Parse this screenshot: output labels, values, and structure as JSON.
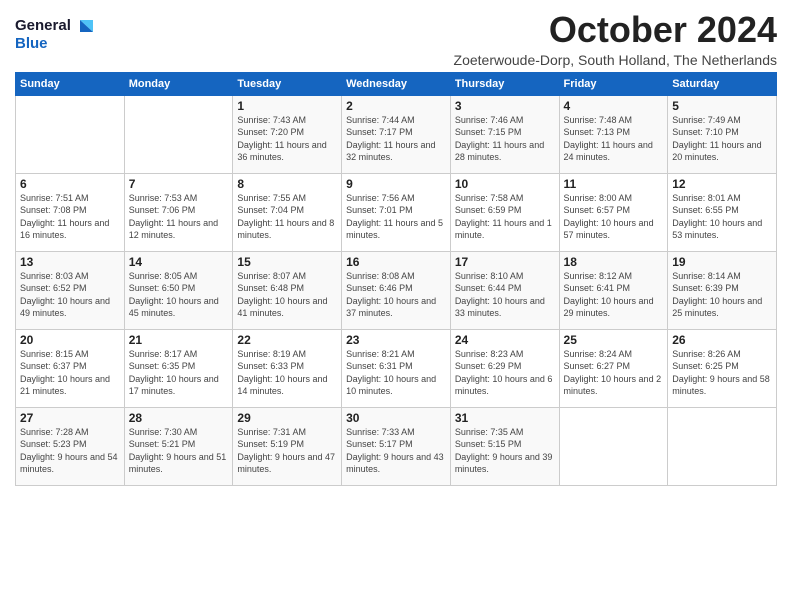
{
  "header": {
    "logo_general": "General",
    "logo_blue": "Blue",
    "month_title": "October 2024",
    "location": "Zoeterwoude-Dorp, South Holland, The Netherlands"
  },
  "days_of_week": [
    "Sunday",
    "Monday",
    "Tuesday",
    "Wednesday",
    "Thursday",
    "Friday",
    "Saturday"
  ],
  "weeks": [
    [
      {
        "day": "",
        "sunrise": "",
        "sunset": "",
        "daylight": ""
      },
      {
        "day": "",
        "sunrise": "",
        "sunset": "",
        "daylight": ""
      },
      {
        "day": "1",
        "sunrise": "Sunrise: 7:43 AM",
        "sunset": "Sunset: 7:20 PM",
        "daylight": "Daylight: 11 hours and 36 minutes."
      },
      {
        "day": "2",
        "sunrise": "Sunrise: 7:44 AM",
        "sunset": "Sunset: 7:17 PM",
        "daylight": "Daylight: 11 hours and 32 minutes."
      },
      {
        "day": "3",
        "sunrise": "Sunrise: 7:46 AM",
        "sunset": "Sunset: 7:15 PM",
        "daylight": "Daylight: 11 hours and 28 minutes."
      },
      {
        "day": "4",
        "sunrise": "Sunrise: 7:48 AM",
        "sunset": "Sunset: 7:13 PM",
        "daylight": "Daylight: 11 hours and 24 minutes."
      },
      {
        "day": "5",
        "sunrise": "Sunrise: 7:49 AM",
        "sunset": "Sunset: 7:10 PM",
        "daylight": "Daylight: 11 hours and 20 minutes."
      }
    ],
    [
      {
        "day": "6",
        "sunrise": "Sunrise: 7:51 AM",
        "sunset": "Sunset: 7:08 PM",
        "daylight": "Daylight: 11 hours and 16 minutes."
      },
      {
        "day": "7",
        "sunrise": "Sunrise: 7:53 AM",
        "sunset": "Sunset: 7:06 PM",
        "daylight": "Daylight: 11 hours and 12 minutes."
      },
      {
        "day": "8",
        "sunrise": "Sunrise: 7:55 AM",
        "sunset": "Sunset: 7:04 PM",
        "daylight": "Daylight: 11 hours and 8 minutes."
      },
      {
        "day": "9",
        "sunrise": "Sunrise: 7:56 AM",
        "sunset": "Sunset: 7:01 PM",
        "daylight": "Daylight: 11 hours and 5 minutes."
      },
      {
        "day": "10",
        "sunrise": "Sunrise: 7:58 AM",
        "sunset": "Sunset: 6:59 PM",
        "daylight": "Daylight: 11 hours and 1 minute."
      },
      {
        "day": "11",
        "sunrise": "Sunrise: 8:00 AM",
        "sunset": "Sunset: 6:57 PM",
        "daylight": "Daylight: 10 hours and 57 minutes."
      },
      {
        "day": "12",
        "sunrise": "Sunrise: 8:01 AM",
        "sunset": "Sunset: 6:55 PM",
        "daylight": "Daylight: 10 hours and 53 minutes."
      }
    ],
    [
      {
        "day": "13",
        "sunrise": "Sunrise: 8:03 AM",
        "sunset": "Sunset: 6:52 PM",
        "daylight": "Daylight: 10 hours and 49 minutes."
      },
      {
        "day": "14",
        "sunrise": "Sunrise: 8:05 AM",
        "sunset": "Sunset: 6:50 PM",
        "daylight": "Daylight: 10 hours and 45 minutes."
      },
      {
        "day": "15",
        "sunrise": "Sunrise: 8:07 AM",
        "sunset": "Sunset: 6:48 PM",
        "daylight": "Daylight: 10 hours and 41 minutes."
      },
      {
        "day": "16",
        "sunrise": "Sunrise: 8:08 AM",
        "sunset": "Sunset: 6:46 PM",
        "daylight": "Daylight: 10 hours and 37 minutes."
      },
      {
        "day": "17",
        "sunrise": "Sunrise: 8:10 AM",
        "sunset": "Sunset: 6:44 PM",
        "daylight": "Daylight: 10 hours and 33 minutes."
      },
      {
        "day": "18",
        "sunrise": "Sunrise: 8:12 AM",
        "sunset": "Sunset: 6:41 PM",
        "daylight": "Daylight: 10 hours and 29 minutes."
      },
      {
        "day": "19",
        "sunrise": "Sunrise: 8:14 AM",
        "sunset": "Sunset: 6:39 PM",
        "daylight": "Daylight: 10 hours and 25 minutes."
      }
    ],
    [
      {
        "day": "20",
        "sunrise": "Sunrise: 8:15 AM",
        "sunset": "Sunset: 6:37 PM",
        "daylight": "Daylight: 10 hours and 21 minutes."
      },
      {
        "day": "21",
        "sunrise": "Sunrise: 8:17 AM",
        "sunset": "Sunset: 6:35 PM",
        "daylight": "Daylight: 10 hours and 17 minutes."
      },
      {
        "day": "22",
        "sunrise": "Sunrise: 8:19 AM",
        "sunset": "Sunset: 6:33 PM",
        "daylight": "Daylight: 10 hours and 14 minutes."
      },
      {
        "day": "23",
        "sunrise": "Sunrise: 8:21 AM",
        "sunset": "Sunset: 6:31 PM",
        "daylight": "Daylight: 10 hours and 10 minutes."
      },
      {
        "day": "24",
        "sunrise": "Sunrise: 8:23 AM",
        "sunset": "Sunset: 6:29 PM",
        "daylight": "Daylight: 10 hours and 6 minutes."
      },
      {
        "day": "25",
        "sunrise": "Sunrise: 8:24 AM",
        "sunset": "Sunset: 6:27 PM",
        "daylight": "Daylight: 10 hours and 2 minutes."
      },
      {
        "day": "26",
        "sunrise": "Sunrise: 8:26 AM",
        "sunset": "Sunset: 6:25 PM",
        "daylight": "Daylight: 9 hours and 58 minutes."
      }
    ],
    [
      {
        "day": "27",
        "sunrise": "Sunrise: 7:28 AM",
        "sunset": "Sunset: 5:23 PM",
        "daylight": "Daylight: 9 hours and 54 minutes."
      },
      {
        "day": "28",
        "sunrise": "Sunrise: 7:30 AM",
        "sunset": "Sunset: 5:21 PM",
        "daylight": "Daylight: 9 hours and 51 minutes."
      },
      {
        "day": "29",
        "sunrise": "Sunrise: 7:31 AM",
        "sunset": "Sunset: 5:19 PM",
        "daylight": "Daylight: 9 hours and 47 minutes."
      },
      {
        "day": "30",
        "sunrise": "Sunrise: 7:33 AM",
        "sunset": "Sunset: 5:17 PM",
        "daylight": "Daylight: 9 hours and 43 minutes."
      },
      {
        "day": "31",
        "sunrise": "Sunrise: 7:35 AM",
        "sunset": "Sunset: 5:15 PM",
        "daylight": "Daylight: 9 hours and 39 minutes."
      },
      {
        "day": "",
        "sunrise": "",
        "sunset": "",
        "daylight": ""
      },
      {
        "day": "",
        "sunrise": "",
        "sunset": "",
        "daylight": ""
      }
    ]
  ]
}
